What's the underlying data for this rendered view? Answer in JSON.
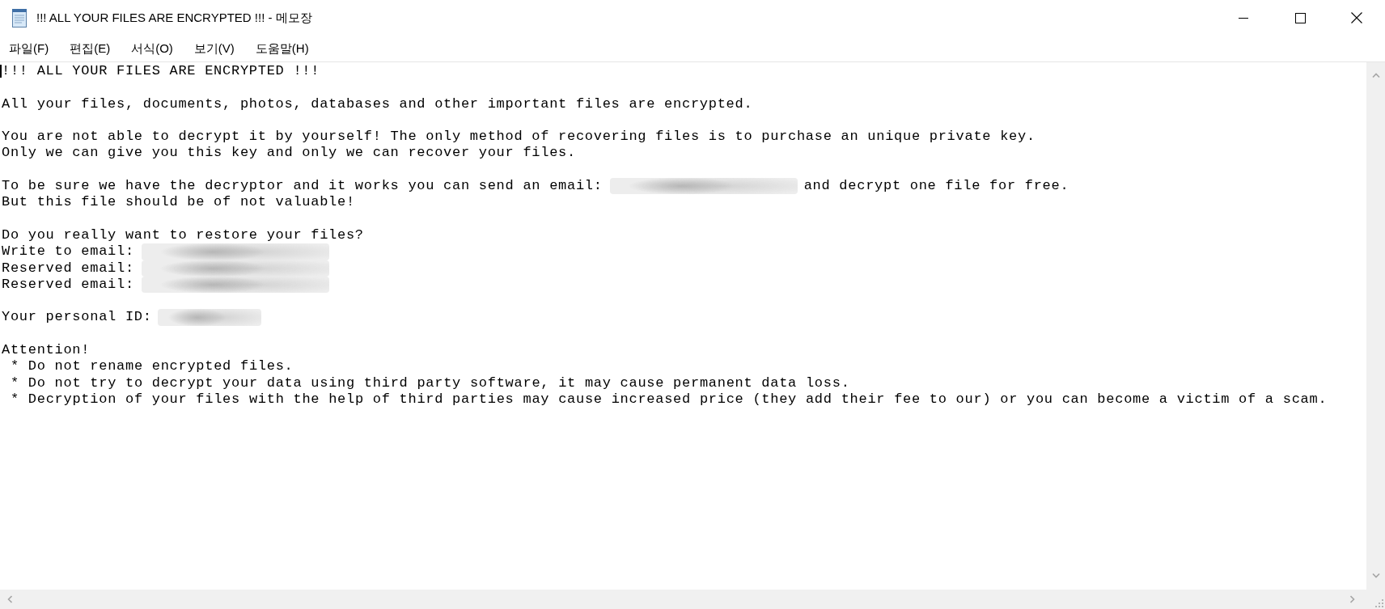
{
  "window": {
    "title": "!!! ALL YOUR FILES ARE ENCRYPTED !!! - 메모장"
  },
  "menu": [
    "파일(F)",
    "편집(E)",
    "서식(O)",
    "보기(V)",
    "도움말(H)"
  ],
  "document": {
    "paragraphs": [
      {
        "lines": [
          {
            "kind": "plain",
            "segments": [
              {
                "kind": "text",
                "text": "!!! ALL YOUR FILES ARE ENCRYPTED !!!"
              }
            ]
          }
        ]
      },
      {
        "lines": [
          {
            "kind": "plain",
            "segments": [
              {
                "kind": "text",
                "text": "All your files, documents, photos, databases and other important files are encrypted."
              }
            ]
          }
        ]
      },
      {
        "lines": [
          {
            "kind": "plain",
            "segments": [
              {
                "kind": "text",
                "text": "You are not able to decrypt it by yourself! The only method of recovering files is to purchase an unique private key."
              }
            ]
          },
          {
            "kind": "plain",
            "segments": [
              {
                "kind": "text",
                "text": "Only we can give you this key and only we can recover your files."
              }
            ]
          }
        ]
      },
      {
        "lines": [
          {
            "kind": "plain",
            "segments": [
              {
                "kind": "text",
                "text": "To be sure we have the decryptor and it works you can send an email:"
              },
              {
                "kind": "redacted_email"
              },
              {
                "kind": "text",
                "text": "and decrypt one file for free."
              }
            ]
          },
          {
            "kind": "plain",
            "segments": [
              {
                "kind": "text",
                "text": "But this file should be of not valuable!"
              }
            ]
          }
        ]
      },
      {
        "lines": [
          {
            "kind": "plain",
            "segments": [
              {
                "kind": "text",
                "text": "Do you really want to restore your files?"
              }
            ]
          },
          {
            "kind": "plain",
            "segments": [
              {
                "kind": "text",
                "text": "Write to email:"
              },
              {
                "kind": "redacted_email"
              }
            ]
          },
          {
            "kind": "plain",
            "segments": [
              {
                "kind": "text",
                "text": "Reserved email:"
              },
              {
                "kind": "redacted_email"
              }
            ]
          },
          {
            "kind": "plain",
            "segments": [
              {
                "kind": "text",
                "text": "Reserved email:"
              },
              {
                "kind": "redacted_email"
              }
            ]
          }
        ]
      },
      {
        "lines": [
          {
            "kind": "plain",
            "segments": [
              {
                "kind": "text",
                "text": "Your personal ID:"
              },
              {
                "kind": "redacted_id"
              }
            ]
          }
        ]
      },
      {
        "lines": [
          {
            "kind": "plain",
            "segments": [
              {
                "kind": "text",
                "text": "Attention!"
              }
            ]
          },
          {
            "kind": "bullet",
            "segments": [
              {
                "kind": "text",
                "text": "* Do not rename encrypted files."
              }
            ]
          },
          {
            "kind": "bullet",
            "segments": [
              {
                "kind": "text",
                "text": "* Do not try to decrypt your data using third party software, it may cause permanent data loss."
              }
            ]
          },
          {
            "kind": "bullet",
            "segments": [
              {
                "kind": "text",
                "text": "* Decryption of your files with the help of third parties may cause increased price (they add their fee to our) or you can become a victim of a scam."
              }
            ]
          }
        ]
      }
    ]
  }
}
